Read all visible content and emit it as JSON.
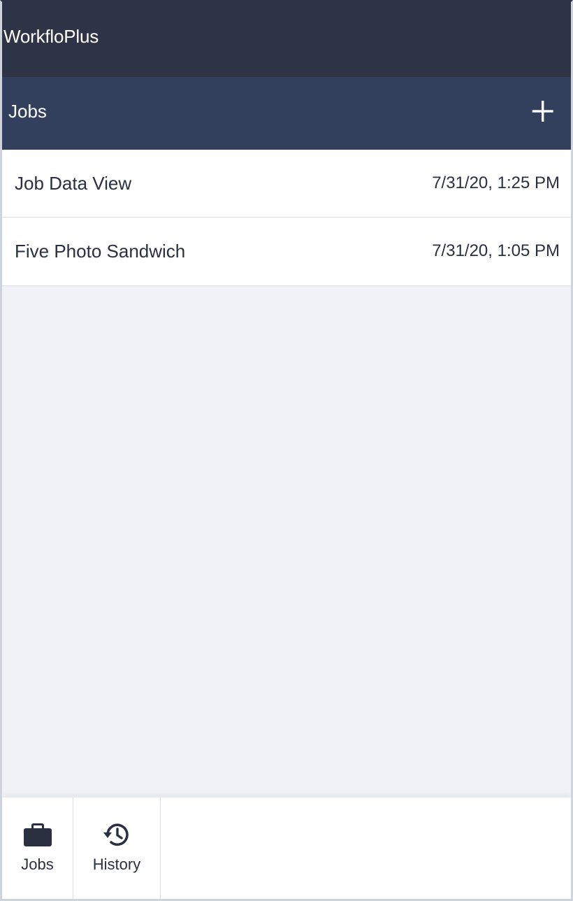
{
  "app": {
    "title": "WorkfloPlus"
  },
  "header": {
    "title": "Jobs",
    "add_icon": "plus-icon"
  },
  "jobs": [
    {
      "name": "Job Data View",
      "date": "7/31/20, 1:25 PM"
    },
    {
      "name": "Five Photo Sandwich",
      "date": "7/31/20, 1:05 PM"
    }
  ],
  "bottom_nav": {
    "items": [
      {
        "label": "Jobs",
        "icon": "briefcase-icon"
      },
      {
        "label": "History",
        "icon": "history-icon"
      }
    ]
  },
  "colors": {
    "app_bar": "#2e3346",
    "section_header": "#32405e",
    "list_background": "#eff2f7",
    "text": "#2b3040"
  }
}
